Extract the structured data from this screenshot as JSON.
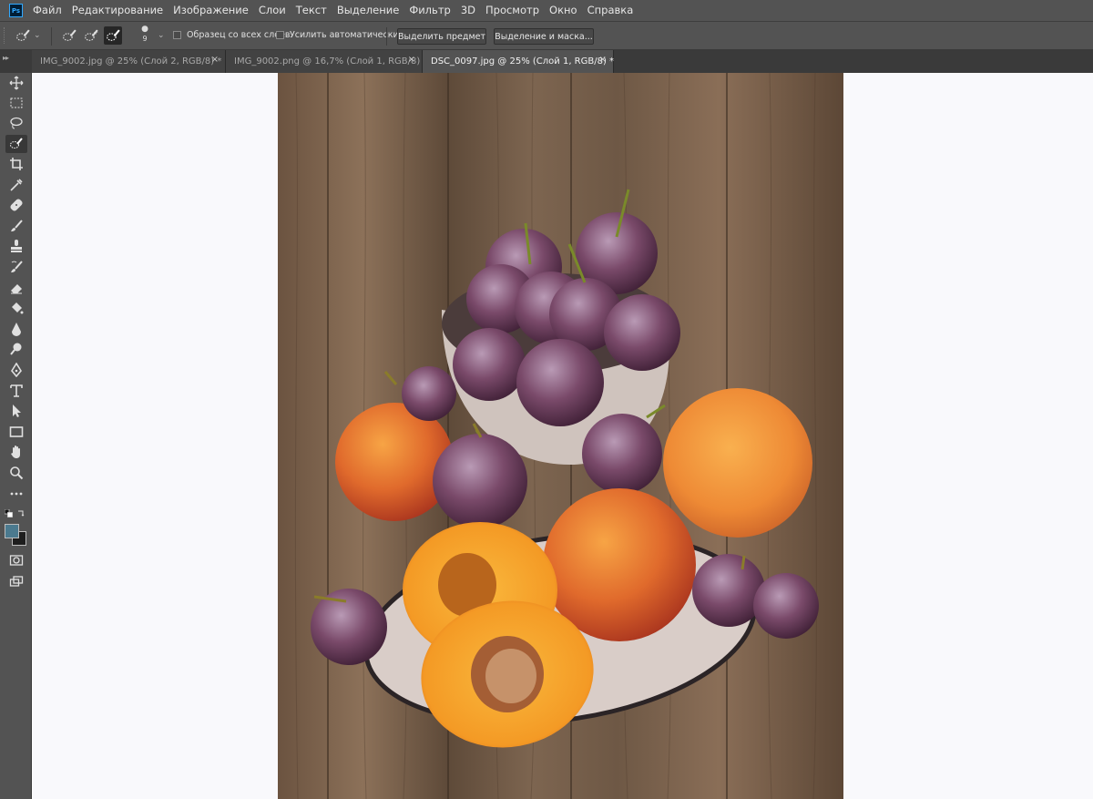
{
  "app": {
    "logo_text": "Ps"
  },
  "menu": [
    "Файл",
    "Редактирование",
    "Изображение",
    "Слои",
    "Текст",
    "Выделение",
    "Фильтр",
    "3D",
    "Просмотр",
    "Окно",
    "Справка"
  ],
  "options": {
    "brush_size": "9",
    "sample_all_layers_label": "Образец со всех слоев",
    "sample_all_layers_checked": false,
    "auto_enhance_label": "Усилить автоматически",
    "auto_enhance_checked": false,
    "select_subject_label": "Выделить предмет",
    "select_and_mask_label": "Выделение и маска..."
  },
  "tabs": [
    {
      "label": "IMG_9002.jpg @ 25% (Слой 2, RGB/8) *",
      "active": false
    },
    {
      "label": "IMG_9002.png @ 16,7% (Слой 1, RGB/8)",
      "active": false
    },
    {
      "label": "DSC_0097.jpg @ 25% (Слой 1, RGB/8) *",
      "active": true
    }
  ],
  "tools": [
    "move-tool-icon",
    "rectangular-marquee-icon",
    "lasso-icon",
    "quick-selection-icon",
    "crop-icon",
    "eyedropper-icon",
    "healing-brush-icon",
    "brush-icon",
    "clone-stamp-icon",
    "history-brush-icon",
    "eraser-icon",
    "paint-bucket-icon",
    "blur-icon",
    "dodge-icon",
    "pen-icon",
    "type-icon",
    "path-selection-icon",
    "rectangle-icon",
    "hand-icon",
    "zoom-icon",
    "more-tools-icon"
  ],
  "colors": {
    "foreground": "#4b7a8f",
    "background": "#1e1e1e",
    "ui_panel": "#535353",
    "canvas_bg": "#f9f9fc"
  },
  "canvas": {
    "image_description": "wooden table with bowl of plums and peaches"
  }
}
